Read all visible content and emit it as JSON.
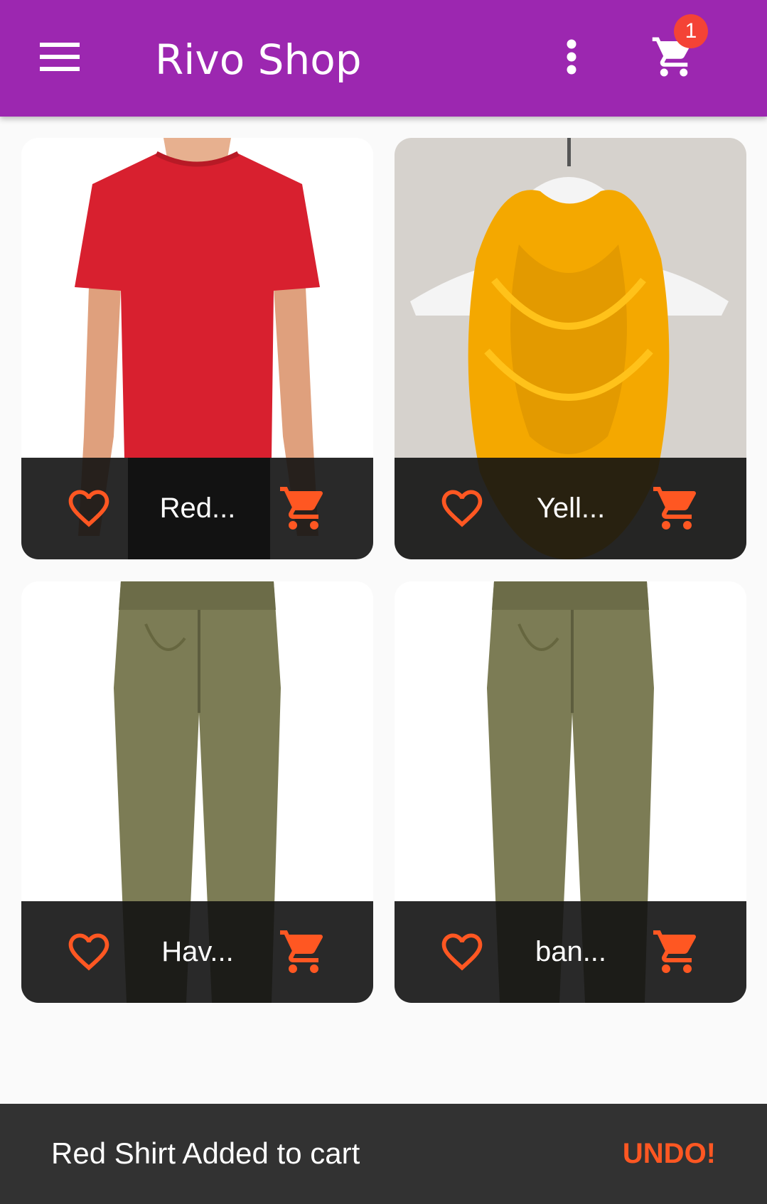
{
  "app_bar": {
    "title": "Rivo Shop",
    "cart_badge": "1",
    "color": "#9c27b0",
    "menu_icon": "menu-icon",
    "more_icon": "more-vert-icon",
    "cart_icon": "shopping-cart-icon"
  },
  "products": [
    {
      "title": "Red...",
      "image": "red t-shirt"
    },
    {
      "title": "Yell...",
      "image": "yellow knit scarf"
    },
    {
      "title": "Hav...",
      "image": "olive pants"
    },
    {
      "title": "ban...",
      "image": "olive pants"
    }
  ],
  "card_icons": {
    "favorite": "heart-outline-icon",
    "add_to_cart": "shopping-cart-icon",
    "accent": "#ff5722"
  },
  "snackbar": {
    "message": "Red Shirt Added to cart",
    "action": "UNDO!"
  }
}
